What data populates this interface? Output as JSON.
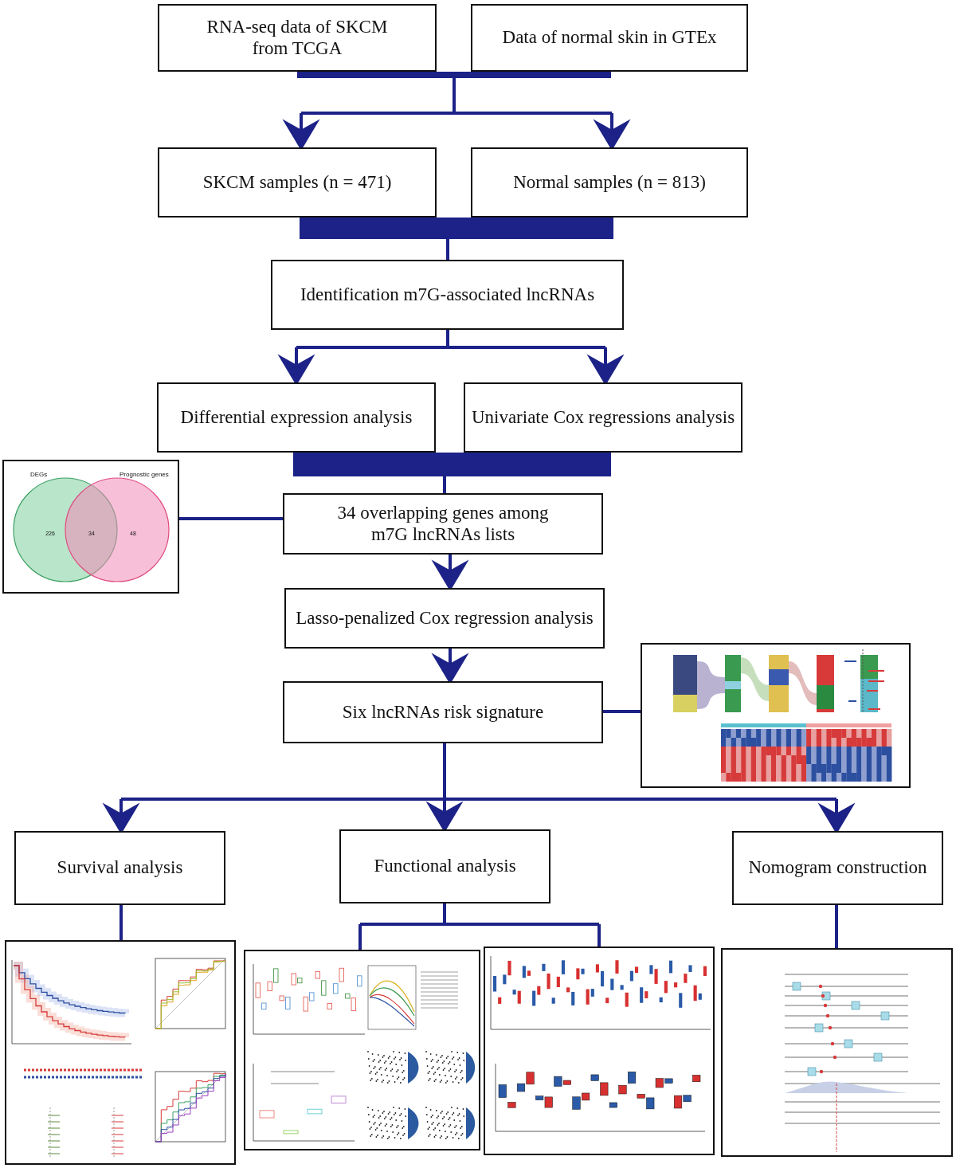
{
  "boxes": [
    {
      "lines": [
        "RNA-seq data of SKCM",
        "from TCGA"
      ]
    },
    {
      "lines": [
        "Data of normal skin in GTEx"
      ]
    },
    {
      "lines": [
        "SKCM samples (n = 471)"
      ]
    },
    {
      "lines": [
        "Normal samples (n = 813)"
      ]
    },
    {
      "lines": [
        "Identification m7G-associated lncRNAs"
      ]
    },
    {
      "lines": [
        "Differential expression analysis"
      ]
    },
    {
      "lines": [
        "Univariate Cox regressions analysis"
      ]
    },
    {
      "lines": [
        "34 overlapping genes among",
        "m7G lncRNAs lists"
      ]
    },
    {
      "lines": [
        "Lasso-penalized Cox regression analysis"
      ]
    },
    {
      "lines": [
        "Six lncRNAs risk signature"
      ]
    },
    {
      "lines": [
        "Survival analysis"
      ]
    },
    {
      "lines": [
        "Functional analysis"
      ]
    },
    {
      "lines": [
        "Nomogram construction"
      ]
    }
  ],
  "venn": {
    "left_label": "DEGs",
    "right_label": "Prognostic genes",
    "left_only": "226",
    "overlap": "34",
    "right_only": "48"
  }
}
